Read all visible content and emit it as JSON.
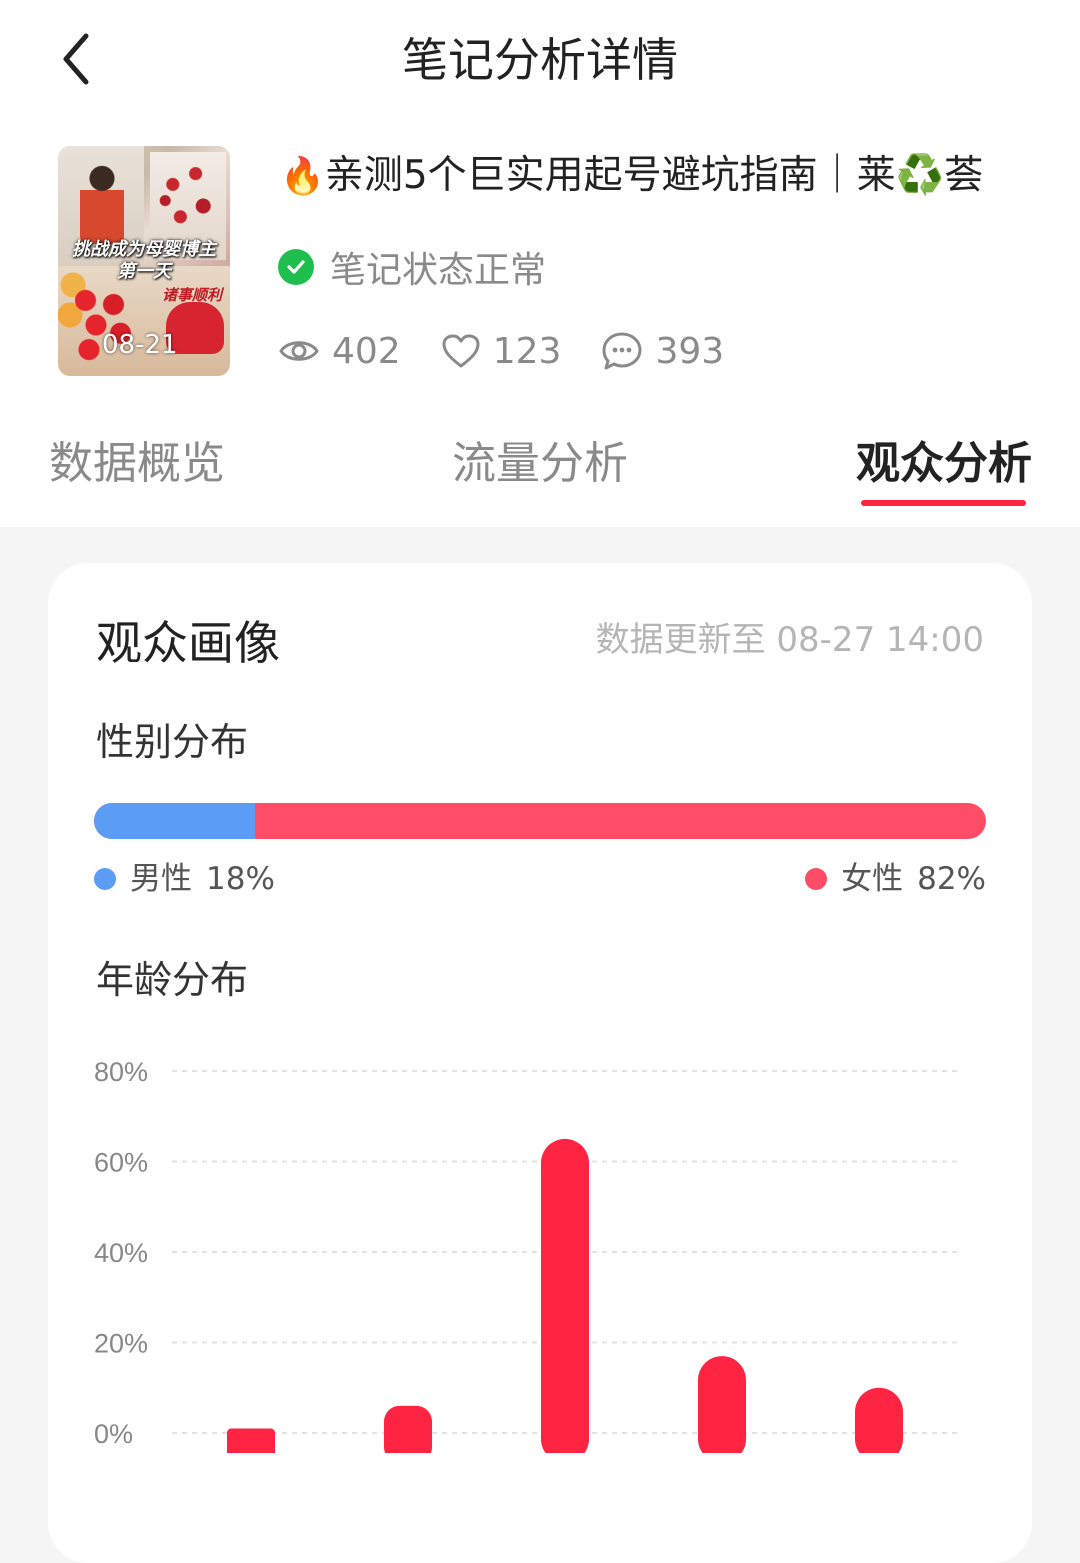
{
  "header": {
    "title": "笔记分析详情"
  },
  "note": {
    "cover_caption_line1": "挑战成为母婴博主",
    "cover_caption_line2": "第一天",
    "cover_script": "诸事顺利",
    "cover_date": "08-21",
    "title_emoji": "🔥",
    "title": "亲测5个巨实用起号避坑指南｜莱♻️荟",
    "status": "笔记状态正常",
    "views": "402",
    "likes": "123",
    "comments": "393"
  },
  "tabs": [
    {
      "label": "数据概览",
      "active": false
    },
    {
      "label": "流量分析",
      "active": false
    },
    {
      "label": "观众分析",
      "active": true
    }
  ],
  "audience": {
    "title": "观众画像",
    "updated": "数据更新至 08-27 14:00",
    "gender": {
      "title": "性别分布",
      "male_label": "男性",
      "male_percent": "18%",
      "male_value": 18,
      "female_label": "女性",
      "female_percent": "82%",
      "female_value": 82
    },
    "age": {
      "title": "年龄分布"
    }
  },
  "colors": {
    "accent": "#ff2442",
    "male": "#5b9cf5",
    "female": "#ff4d67",
    "status_ok": "#1fbf4f"
  },
  "chart_data": {
    "type": "bar",
    "title": "年龄分布",
    "y_ticks": [
      "80%",
      "60%",
      "40%",
      "20%",
      "0%"
    ],
    "ylim": [
      0,
      80
    ],
    "values": [
      1,
      6,
      65,
      17,
      10
    ],
    "grid": true
  }
}
